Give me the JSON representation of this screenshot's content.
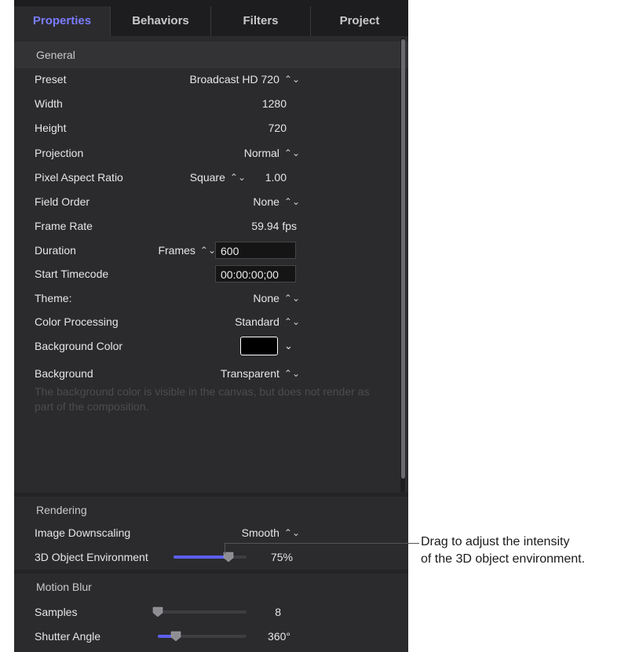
{
  "tabs": [
    {
      "label": "Properties",
      "active": true
    },
    {
      "label": "Behaviors",
      "active": false
    },
    {
      "label": "Filters",
      "active": false
    },
    {
      "label": "Project",
      "active": false
    }
  ],
  "general": {
    "title": "General",
    "preset": {
      "label": "Preset",
      "value": "Broadcast HD 720"
    },
    "width": {
      "label": "Width",
      "value": "1280"
    },
    "height": {
      "label": "Height",
      "value": "720"
    },
    "projection": {
      "label": "Projection",
      "value": "Normal"
    },
    "pixel_aspect": {
      "label": "Pixel Aspect Ratio",
      "value": "Square",
      "number": "1.00"
    },
    "field_order": {
      "label": "Field Order",
      "value": "None"
    },
    "frame_rate": {
      "label": "Frame Rate",
      "value": "59.94 fps"
    },
    "duration": {
      "label": "Duration",
      "unit": "Frames",
      "value": "600"
    },
    "start_timecode": {
      "label": "Start Timecode",
      "value": "00:00:00;00"
    },
    "theme": {
      "label": "Theme:",
      "value": "None"
    },
    "color_processing": {
      "label": "Color Processing",
      "value": "Standard"
    },
    "background_color": {
      "label": "Background Color",
      "color": "#000000"
    },
    "background": {
      "label": "Background",
      "value": "Transparent"
    },
    "description": "The background color is visible in the canvas, but does not render as part of the composition."
  },
  "rendering": {
    "title": "Rendering",
    "image_downscaling": {
      "label": "Image Downscaling",
      "value": "Smooth"
    },
    "object_environment": {
      "label": "3D Object Environment",
      "value": "75%",
      "level": 0.75
    }
  },
  "motion_blur": {
    "title": "Motion Blur",
    "samples": {
      "label": "Samples",
      "value": "8",
      "level": 0.0
    },
    "shutter_angle": {
      "label": "Shutter Angle",
      "value": "360°",
      "level": 0.2
    }
  },
  "callout": {
    "line1": "Drag to adjust the intensity",
    "line2": "of the 3D object environment."
  },
  "colors": {
    "accent": "#7a7cff",
    "slider_fill": "#5d5ff0",
    "panel_bg": "#2b2b2d"
  }
}
